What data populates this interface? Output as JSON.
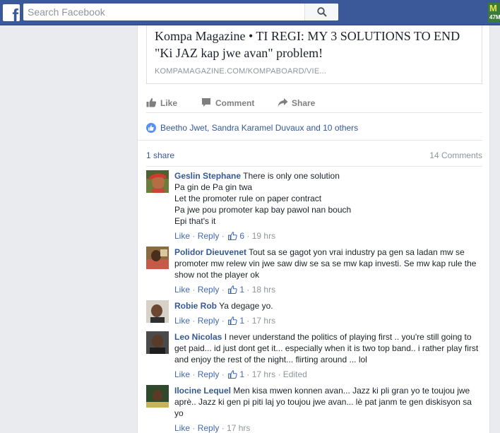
{
  "search": {
    "placeholder": "Search Facebook"
  },
  "corner_badge": {
    "line1": "M",
    "line2": "47M"
  },
  "link_preview": {
    "title": "Kompa Magazine • TI REGI: MY 3 SOLUTIONS TO END \"Ki JAZ kap jwe avan\" problem!",
    "domain": "KOMPAMAGAZINE.COM/KOMPABOARD/VIE..."
  },
  "actions": {
    "like": "Like",
    "comment": "Comment",
    "share": "Share"
  },
  "reactions": {
    "text": "Beetho Jwet, Sandra Karamel Duvaux and 10 others"
  },
  "stats": {
    "shares": "1 share",
    "comments": "14 Comments"
  },
  "comments": [
    {
      "name": "Geslin Stephane",
      "lines": [
        "There is only one solution",
        "Pa gin de Pa gin twa",
        "Let the promoter rule on paper contract",
        "Pa jwe pou promoter kap bay pawol nan bouch",
        "Epi that's it"
      ],
      "like": "Like",
      "reply": "Reply",
      "likes": "6",
      "time": "19 hrs",
      "edited": ""
    },
    {
      "name": "Polidor Dieuvenet",
      "text": "Tout sa se gagot yon vrai industry pa gen sa ladan mw se promoter mw relew vin jwe saw diw se sa se mw kap investi. Se mw kap rule the show not the player ok",
      "like": "Like",
      "reply": "Reply",
      "likes": "1",
      "time": "18 hrs",
      "edited": ""
    },
    {
      "name": "Robie Rob",
      "text": "Ya degage yo.",
      "like": "Like",
      "reply": "Reply",
      "likes": "1",
      "time": "17 hrs",
      "edited": ""
    },
    {
      "name": "Leo Nicolas",
      "text": "I never understand the politics of playing first .. you're still going to get paid... id just dont get it... especially when it is two top band.. i rather play first and enjoy the rest of the night... flirting around ... lol",
      "like": "Like",
      "reply": "Reply",
      "likes": "1",
      "time": "17 hrs",
      "edited": "Edited"
    },
    {
      "name": "Ilocine Lequel",
      "text": "Men kisa mwen konnen avan... Jazz ki pli gran yo te toujou jwe aprè.. Jazz ki gen pi piti laj yo toujou jwe avan... lè pat janm te gen diskisyon sa yo",
      "like": "Like",
      "reply": "Reply",
      "likes": "",
      "time": "17 hrs",
      "edited": ""
    }
  ],
  "colors": {
    "topbar": "#3b5998",
    "link": "#365899",
    "meta": "#90949c",
    "background": "#e9ebee"
  }
}
